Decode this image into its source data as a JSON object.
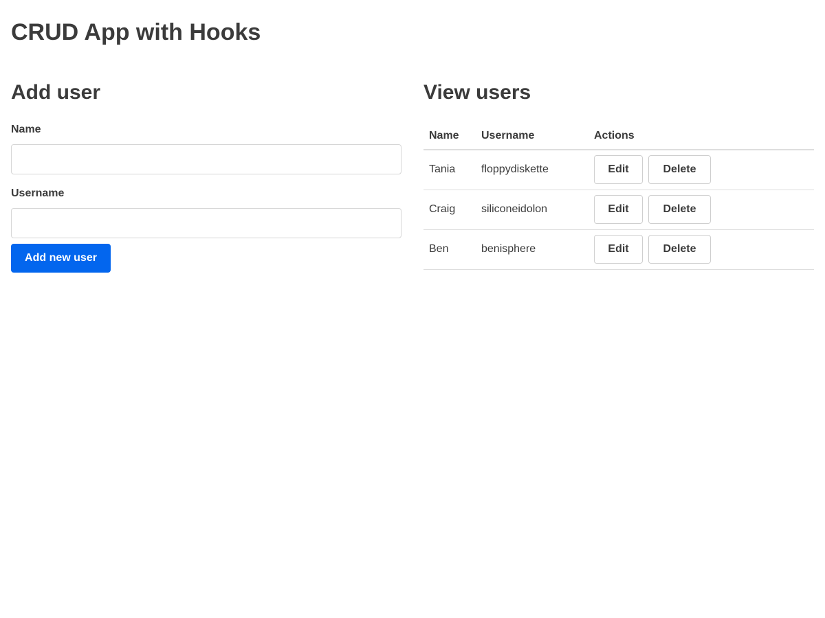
{
  "app": {
    "title": "CRUD App with Hooks"
  },
  "add_user": {
    "heading": "Add user",
    "name_label": "Name",
    "name_value": "",
    "username_label": "Username",
    "username_value": "",
    "submit_label": "Add new user"
  },
  "view_users": {
    "heading": "View users",
    "columns": [
      "Name",
      "Username",
      "Actions"
    ],
    "rows": [
      {
        "name": "Tania",
        "username": "floppydiskette"
      },
      {
        "name": "Craig",
        "username": "siliconeidolon"
      },
      {
        "name": "Ben",
        "username": "benisphere"
      }
    ],
    "edit_label": "Edit",
    "delete_label": "Delete"
  },
  "colors": {
    "primary": "#0366ee",
    "text": "#3b3b3b",
    "border": "#dedede"
  }
}
